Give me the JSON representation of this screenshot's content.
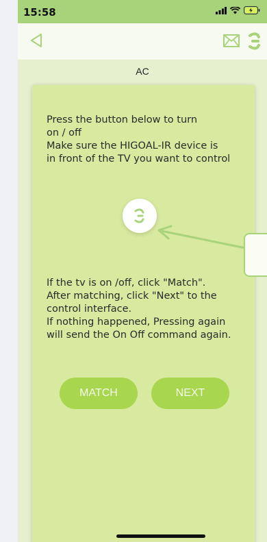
{
  "status": {
    "time": "15:58"
  },
  "header": {
    "title": "AC"
  },
  "instructions": {
    "top": "Press the button below to turn\non / off\nMake sure the HIGOAL-IR device is\nin front of the TV you want to control",
    "bottom": "If the tv is on /off,  click \"Match\".\nAfter matching,  click \"Next\" to the\ncontrol interface.\nIf nothing happened,  Pressing again\nwill send the On Off command again."
  },
  "buttons": {
    "match": "MATCH",
    "next": "NEXT"
  },
  "colors": {
    "accent": "#a9d37a",
    "button": "#a9d64f",
    "card": "#d7ea9f"
  },
  "icons": [
    "back-icon",
    "mail-icon",
    "logo-icon",
    "power-icon"
  ]
}
